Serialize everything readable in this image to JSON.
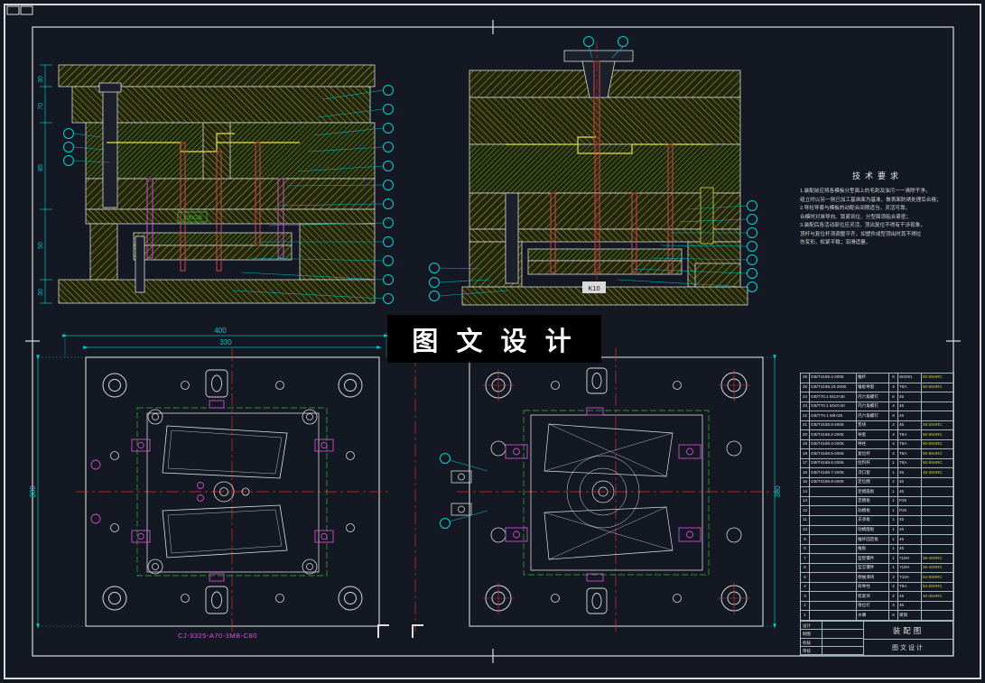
{
  "colors": {
    "background": "#141823",
    "line": "#d8d8d8",
    "cyan": "#00c8c8",
    "hatch_yellow": "#a8ac2e",
    "red": "#cf3333",
    "magenta": "#cc4ccc",
    "green": "#2fbf2f"
  },
  "watermark": {
    "text": "图 文 设 计"
  },
  "tech_requirements": {
    "title": "技术要求",
    "lines": [
      "1.装配前应将各模板分型面上的毛刺及油污一一清除干净，",
      "组立时以另一侧已加工基准面为基准，做表面防锈处理后合格；",
      "2.导柱导套与模板的动配合间隙适当，灵活可靠，",
      "合模时对准导向、锁紧到位、分型面须贴合紧密；",
      "3.装配后各活动部位应灵活，顶出复位不得有干涉现象，",
      "顶杆与复位杆须调整平齐，如塑件成型顶出时其不得拉",
      "伤变形，松紧平稳；润滑适量。"
    ]
  },
  "dims": {
    "section_left": [
      "30",
      "70",
      "85",
      "50",
      "30"
    ],
    "plan_left": {
      "w1": "400",
      "w2": "330",
      "h": "380"
    },
    "plan_right": {
      "h": "380"
    }
  },
  "labels": {
    "part_number": "CJ-3325-A70-3MB-C80",
    "k10": "K10",
    "insert_tag": "100GB"
  },
  "bom": {
    "columns_order": [
      "no",
      "code",
      "name",
      "qty",
      "mat",
      "note"
    ],
    "rows": [
      {
        "no": "26",
        "code": "GB/T4169.4-2006",
        "name": "推杆",
        "qty": "8",
        "mat": "SKD61",
        "note": "50-55HRC"
      },
      {
        "no": "25",
        "code": "GB/T4169.23-2006",
        "name": "推板导套",
        "qty": "4",
        "mat": "T8A",
        "note": "50-55HRC"
      },
      {
        "no": "24",
        "code": "GB/T70.1 M12×35",
        "name": "内六角螺钉",
        "qty": "6",
        "mat": "45",
        "note": ""
      },
      {
        "no": "23",
        "code": "GB/T70.1 M10×30",
        "name": "内六角螺钉",
        "qty": "4",
        "mat": "45",
        "note": ""
      },
      {
        "no": "22",
        "code": "GB/T70.1 M8×25",
        "name": "内六角螺钉",
        "qty": "8",
        "mat": "45",
        "note": ""
      },
      {
        "no": "21",
        "code": "GB/T4169.8-2006",
        "name": "垫块",
        "qty": "2",
        "mat": "45",
        "note": "28-32HRC"
      },
      {
        "no": "20",
        "code": "GB/T4169.2-2006",
        "name": "导套",
        "qty": "4",
        "mat": "T8A",
        "note": "50-55HRC"
      },
      {
        "no": "19",
        "code": "GB/T4169.3-2006",
        "name": "导柱",
        "qty": "4",
        "mat": "T8A",
        "note": "50-55HRC"
      },
      {
        "no": "18",
        "code": "GB/T4169.5-2006",
        "name": "复位杆",
        "qty": "4",
        "mat": "T8A",
        "note": "50-55HRC"
      },
      {
        "no": "17",
        "code": "GB/T4169.6-2006",
        "name": "拉料杆",
        "qty": "1",
        "mat": "T8A",
        "note": "50-55HRC"
      },
      {
        "no": "16",
        "code": "GB/T4169.7-2006",
        "name": "浇口套",
        "qty": "1",
        "mat": "45",
        "note": "40-45HRC"
      },
      {
        "no": "15",
        "code": "GB/T4169.9-2006",
        "name": "定位圈",
        "qty": "1",
        "mat": "45",
        "note": ""
      },
      {
        "no": "14",
        "code": "",
        "name": "定模座板",
        "qty": "1",
        "mat": "45",
        "note": ""
      },
      {
        "no": "13",
        "code": "",
        "name": "定模板",
        "qty": "1",
        "mat": "P20",
        "note": ""
      },
      {
        "no": "12",
        "code": "",
        "name": "动模板",
        "qty": "1",
        "mat": "P20",
        "note": ""
      },
      {
        "no": "11",
        "code": "",
        "name": "支承板",
        "qty": "1",
        "mat": "45",
        "note": ""
      },
      {
        "no": "10",
        "code": "",
        "name": "动模座板",
        "qty": "1",
        "mat": "45",
        "note": ""
      },
      {
        "no": "9",
        "code": "",
        "name": "推杆固定板",
        "qty": "1",
        "mat": "45",
        "note": ""
      },
      {
        "no": "8",
        "code": "",
        "name": "推板",
        "qty": "1",
        "mat": "45",
        "note": ""
      },
      {
        "no": "7",
        "code": "",
        "name": "型腔镶件",
        "qty": "1",
        "mat": "718H",
        "note": "36-40HRC"
      },
      {
        "no": "6",
        "code": "",
        "name": "型芯镶件",
        "qty": "1",
        "mat": "718H",
        "note": "36-40HRC"
      },
      {
        "no": "5",
        "code": "",
        "name": "侧抽滑块",
        "qty": "2",
        "mat": "T10A",
        "note": "54-58HRC"
      },
      {
        "no": "4",
        "code": "",
        "name": "斜导柱",
        "qty": "2",
        "mat": "T8A",
        "note": "54-58HRC"
      },
      {
        "no": "3",
        "code": "",
        "name": "楔紧块",
        "qty": "2",
        "mat": "45",
        "note": "40-45HRC"
      },
      {
        "no": "2",
        "code": "",
        "name": "限位钉",
        "qty": "4",
        "mat": "45",
        "note": ""
      },
      {
        "no": "1",
        "code": "",
        "name": "水嘴",
        "qty": "8",
        "mat": "黄铜",
        "note": ""
      }
    ]
  },
  "title_block": {
    "drawing_name": "装配图",
    "company": "图文设计",
    "left_labels": [
      "设计",
      "制图",
      "校核",
      "审核"
    ]
  }
}
